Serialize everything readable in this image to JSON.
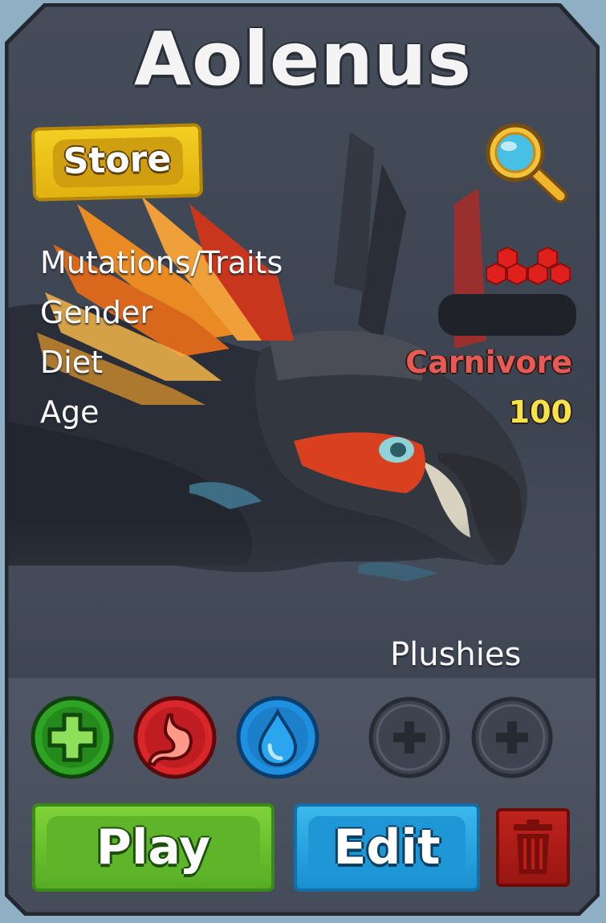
{
  "creature": {
    "name": "Aolenus"
  },
  "store_button": {
    "label": "Store"
  },
  "search": {
    "icon": "magnifier-icon"
  },
  "stats": [
    {
      "label": "Mutations/Traits",
      "value": "",
      "icon": "mutation-cluster-icon"
    },
    {
      "label": "Gender",
      "value": "",
      "redacted": true
    },
    {
      "label": "Diet",
      "value": "Carnivore",
      "color": "#e85a55"
    },
    {
      "label": "Age",
      "value": "100",
      "color": "#f6e24a"
    }
  ],
  "care_buttons": [
    {
      "name": "heal",
      "icon": "plus-icon",
      "color": "#2fa324"
    },
    {
      "name": "feed",
      "icon": "stomach-icon",
      "color": "#d8262a"
    },
    {
      "name": "drink",
      "icon": "water-drop-icon",
      "color": "#1f8fe0"
    }
  ],
  "plushies": {
    "label": "Plushies",
    "slots": [
      {
        "icon": "plus-icon"
      },
      {
        "icon": "plus-icon"
      }
    ]
  },
  "actions": {
    "play_label": "Play",
    "edit_label": "Edit",
    "delete_icon": "trash-icon"
  },
  "colors": {
    "panel": "#434a57",
    "play": "#5eb52a",
    "edit": "#1f97d6",
    "delete": "#b01d18",
    "store": "#e6b814"
  }
}
